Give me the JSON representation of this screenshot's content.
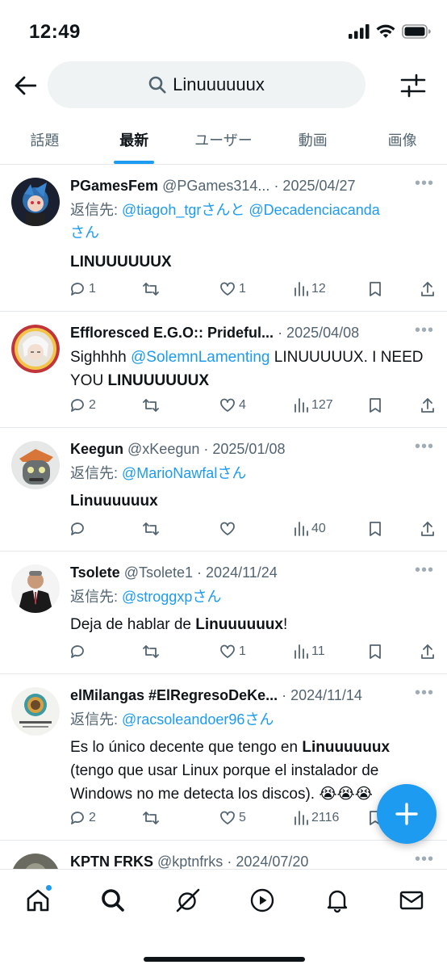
{
  "status_bar": {
    "time": "12:49"
  },
  "search": {
    "query": "Linuuuuuux"
  },
  "tabs": [
    "話題",
    "最新",
    "ユーザー",
    "動画",
    "画像"
  ],
  "tweets": [
    {
      "name": "PGamesFem",
      "handle": "@PGames314...",
      "date": "· 2025/04/27",
      "reply_prefix": "返信先: ",
      "reply_mention1": "@tiagoh_tgr",
      "reply_mid": "さんと",
      "reply_mention2": "@Decadenciacanda",
      "reply_suffix": "さん",
      "body_bold": "LINUUUUUUX",
      "replies": "1",
      "retweets": "",
      "likes": "1",
      "views": "12"
    },
    {
      "name": "Effloresced E.G.O:: Prideful...",
      "handle": "",
      "date": "· 2025/04/08",
      "body_pre": "Sighhhh ",
      "body_mention": "@SolemnLamenting",
      "body_mid": " LINUUUUUX. I NEED YOU ",
      "body_bold": "LINUUUUUUX",
      "replies": "2",
      "retweets": "",
      "likes": "4",
      "views": "127"
    },
    {
      "name": "Keegun",
      "handle": "@xKeegun",
      "date": "· 2025/01/08",
      "reply_prefix": "返信先: ",
      "reply_mention1": "@MarioNawfal",
      "reply_suffix": "さん",
      "body_bold": "Linuuuuuux",
      "replies": "",
      "retweets": "",
      "likes": "",
      "views": "40"
    },
    {
      "name": "Tsolete",
      "handle": "@Tsolete1",
      "date": "· 2024/11/24",
      "reply_prefix": "返信先: ",
      "reply_mention1": "@stroggxp",
      "reply_suffix": "さん",
      "body_pre": "Deja de hablar de ",
      "body_bold": "Linuuuuuux",
      "body_post": "!",
      "replies": "",
      "retweets": "",
      "likes": "1",
      "views": "11"
    },
    {
      "name": "elMilangas #ElRegresoDeKe...",
      "handle": "",
      "date": "· 2024/11/14",
      "reply_prefix": "返信先: ",
      "reply_mention1": "@racsoleandoer96",
      "reply_suffix": "さん",
      "body_pre": "Es lo único decente que tengo en ",
      "body_bold": "Linuuuuuux",
      "body_post": " (tengo que usar Linux porque el instalador de Windows no me detecta los discos). 😭😭😭",
      "replies": "2",
      "retweets": "",
      "likes": "5",
      "views": "2116"
    },
    {
      "name": "KPTN FRKS",
      "handle": "@kptnfrks",
      "date": "· 2024/07/20"
    }
  ],
  "icons": {
    "back": "arrow-left-icon",
    "search": "search-icon",
    "filter": "filter-sliders-icon",
    "reply": "reply-icon",
    "retweet": "retweet-icon",
    "like": "heart-icon",
    "views": "views-icon",
    "bookmark": "bookmark-icon",
    "share": "share-icon",
    "compose": "plus-icon",
    "nav": [
      "home-icon",
      "search-icon",
      "grok-icon",
      "video-icon",
      "bell-icon",
      "mail-icon"
    ]
  },
  "colors": {
    "accent": "#1d9bf0",
    "text": "#0f1419",
    "muted": "#536471"
  }
}
